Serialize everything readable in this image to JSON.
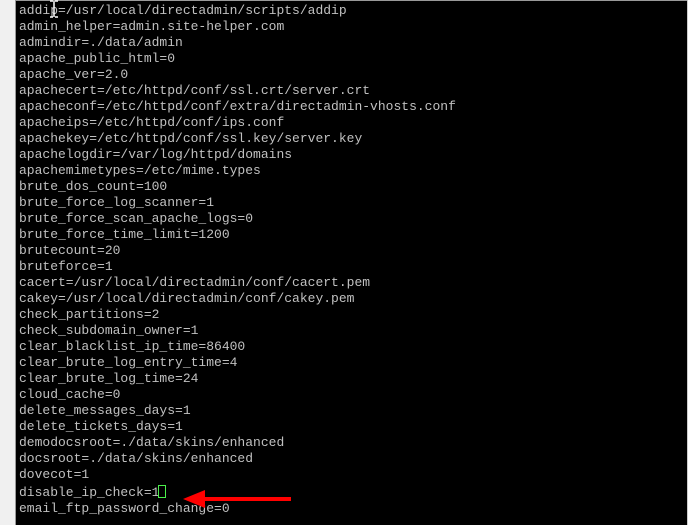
{
  "terminal": {
    "lines": [
      "addip=/usr/local/directadmin/scripts/addip",
      "admin_helper=admin.site-helper.com",
      "admindir=./data/admin",
      "apache_public_html=0",
      "apache_ver=2.0",
      "apachecert=/etc/httpd/conf/ssl.crt/server.crt",
      "apacheconf=/etc/httpd/conf/extra/directadmin-vhosts.conf",
      "apacheips=/etc/httpd/conf/ips.conf",
      "apachekey=/etc/httpd/conf/ssl.key/server.key",
      "apachelogdir=/var/log/httpd/domains",
      "apachemimetypes=/etc/mime.types",
      "brute_dos_count=100",
      "brute_force_log_scanner=1",
      "brute_force_scan_apache_logs=0",
      "brute_force_time_limit=1200",
      "brutecount=20",
      "bruteforce=1",
      "cacert=/usr/local/directadmin/conf/cacert.pem",
      "cakey=/usr/local/directadmin/conf/cakey.pem",
      "check_partitions=2",
      "check_subdomain_owner=1",
      "clear_blacklist_ip_time=86400",
      "clear_brute_log_entry_time=4",
      "clear_brute_log_time=24",
      "cloud_cache=0",
      "delete_messages_days=1",
      "delete_tickets_days=1",
      "demodocsroot=./data/skins/enhanced",
      "docsroot=./data/skins/enhanced",
      "dovecot=1",
      "disable_ip_check=1",
      "email_ftp_password_change=0"
    ],
    "highlighted_line_index": 30
  }
}
